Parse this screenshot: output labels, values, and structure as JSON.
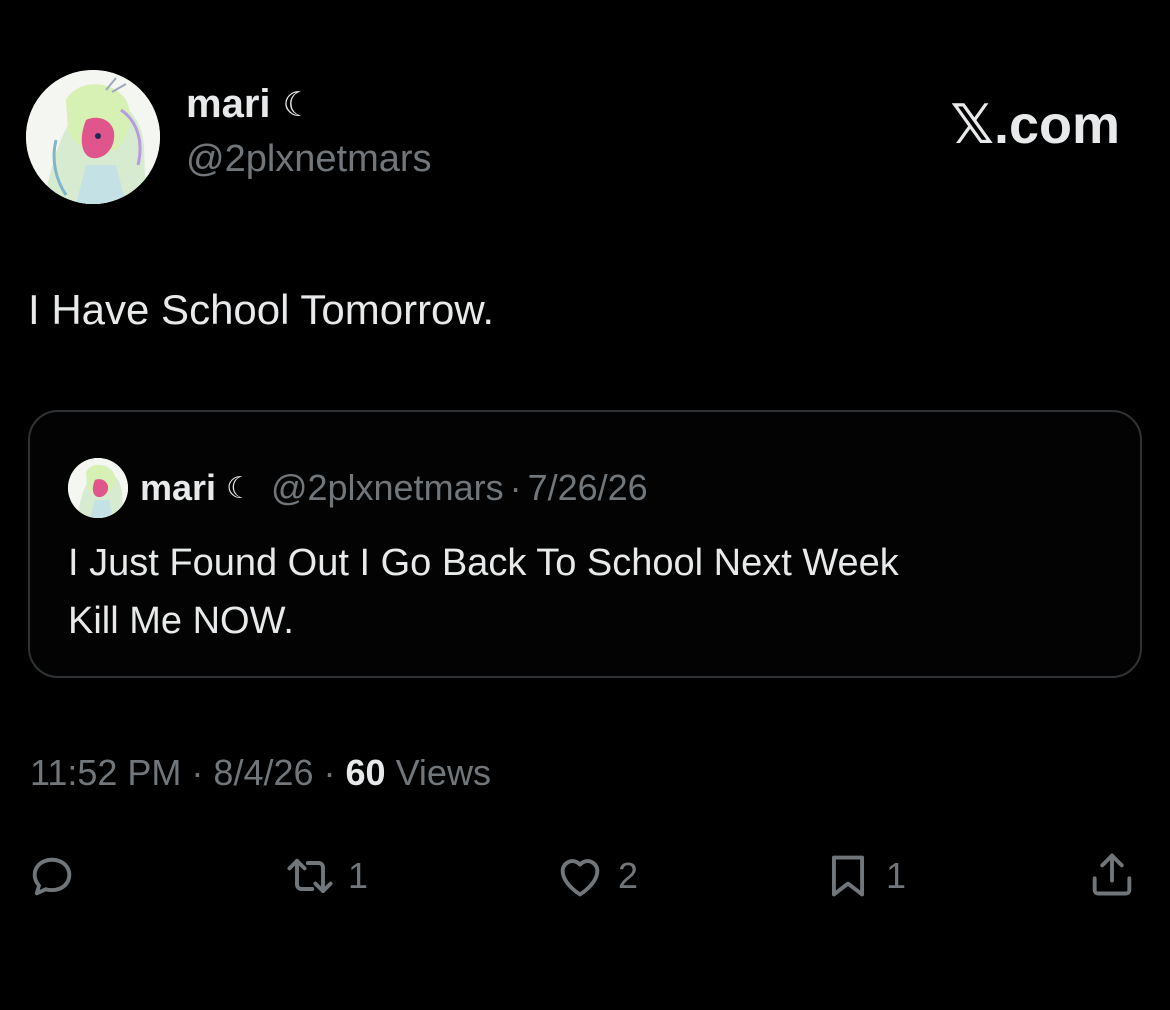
{
  "author": {
    "display_name": "mari",
    "name_suffix": "☾",
    "handle": "@2plxnetmars"
  },
  "brand": {
    "x_glyph": "𝕏",
    "text": ".com"
  },
  "tweet": {
    "text": "I Have School Tomorrow."
  },
  "quoted_tweet": {
    "display_name": "mari",
    "name_suffix": "☾",
    "handle": "@2plxnetmars",
    "separator": "·",
    "date": "7/26/26",
    "text_line_1": "I Just Found Out I Go Back To School Next Week",
    "text_line_2": "Kill Me NOW."
  },
  "meta": {
    "time": "11:52 PM",
    "separator": "·",
    "date": "8/4/26",
    "views_count": "60",
    "views_label": "Views"
  },
  "actions": {
    "reply_icon": "reply-icon",
    "retweet_icon": "retweet-icon",
    "retweet_count": "1",
    "like_icon": "heart-icon",
    "like_count": "2",
    "bookmark_icon": "bookmark-icon",
    "bookmark_count": "1",
    "share_icon": "share-icon"
  },
  "colors": {
    "background": "#000000",
    "primary_text": "#e7e9ea",
    "secondary_text": "#71767b",
    "border": "#2f3336"
  }
}
